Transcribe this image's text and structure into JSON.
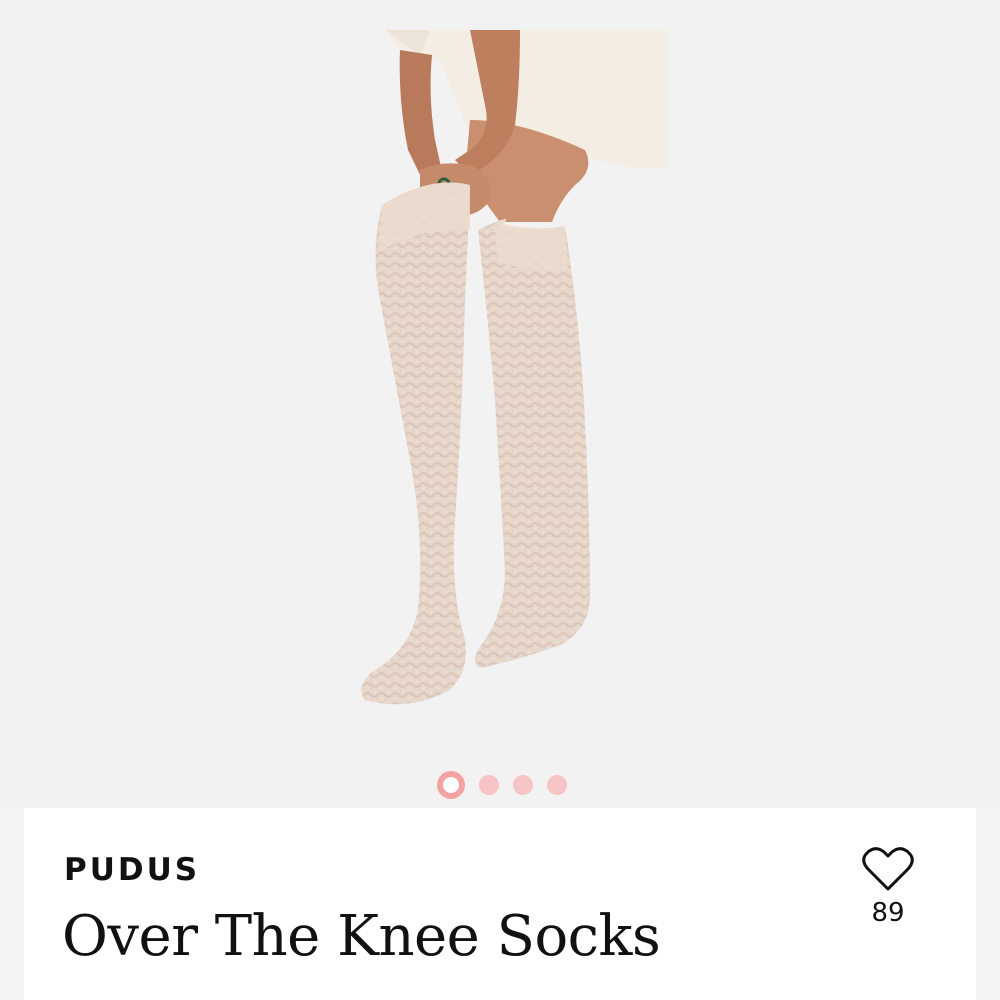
{
  "product": {
    "brand": "PUDUS",
    "title": "Over The Knee Socks",
    "likes": "89",
    "image": "over-the-knee-socks-photo"
  },
  "gallery": {
    "total_images": 4,
    "active_index": 0
  },
  "colors": {
    "dot_active": "#f4a3a3",
    "dot_inactive": "#f6c4c4",
    "sock": "#e8d8cc"
  },
  "icons": {
    "like": "heart-outline-icon"
  }
}
